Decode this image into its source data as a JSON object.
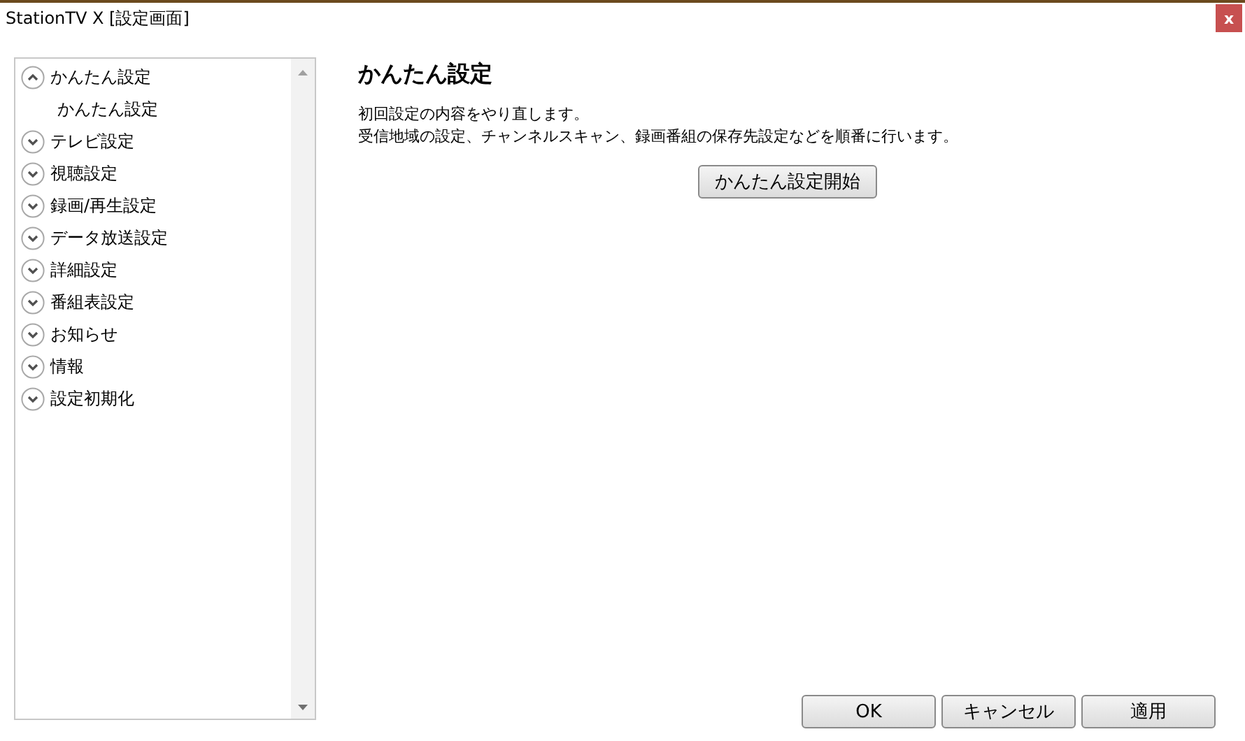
{
  "window": {
    "title": "StationTV X [設定画面]",
    "close": "x"
  },
  "sidebar": {
    "items": [
      {
        "label": "かんたん設定",
        "expanded": true,
        "children": [
          {
            "label": "かんたん設定"
          }
        ]
      },
      {
        "label": "テレビ設定",
        "expanded": false
      },
      {
        "label": "視聴設定",
        "expanded": false
      },
      {
        "label": "録画/再生設定",
        "expanded": false
      },
      {
        "label": "データ放送設定",
        "expanded": false
      },
      {
        "label": "詳細設定",
        "expanded": false
      },
      {
        "label": "番組表設定",
        "expanded": false
      },
      {
        "label": "お知らせ",
        "expanded": false
      },
      {
        "label": "情報",
        "expanded": false
      },
      {
        "label": "設定初期化",
        "expanded": false
      }
    ]
  },
  "content": {
    "heading": "かんたん設定",
    "description": [
      "初回設定の内容をやり直します。",
      "受信地域の設定、チャンネルスキャン、録画番組の保存先設定などを順番に行います。"
    ],
    "button": "かんたん設定開始"
  },
  "buttons": [
    "OK",
    "キャンセル",
    "適用"
  ]
}
